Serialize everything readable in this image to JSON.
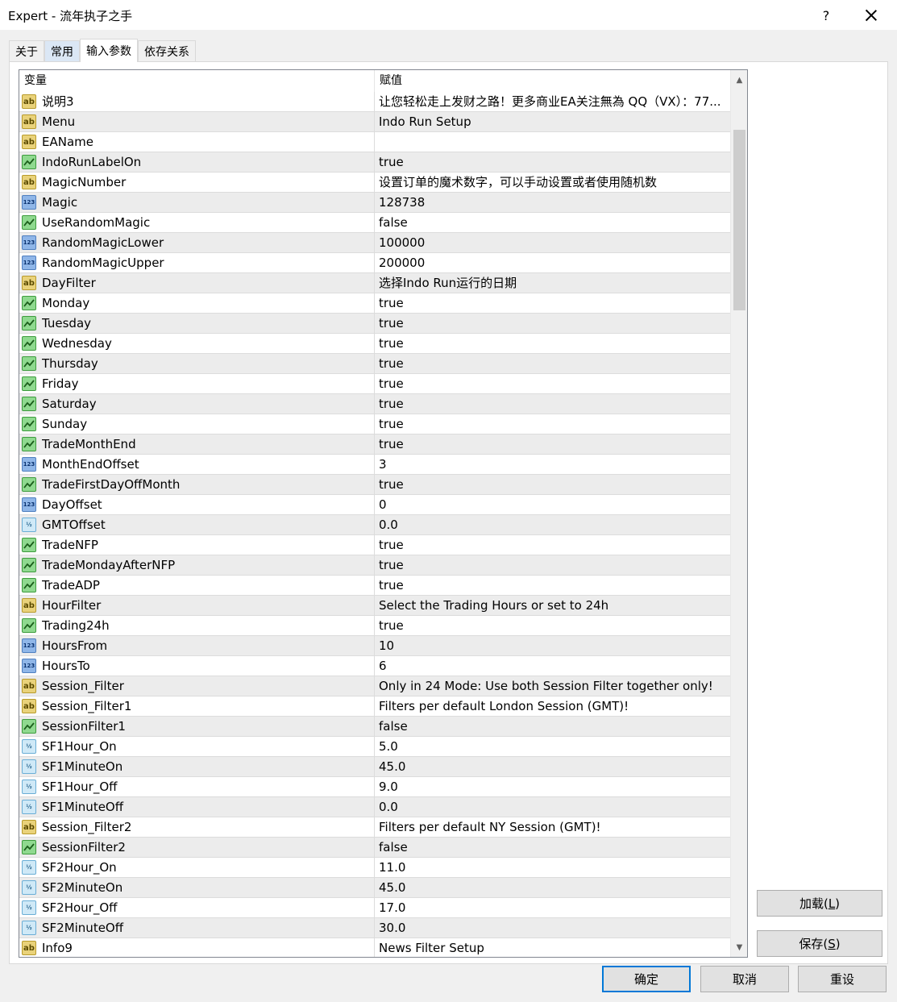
{
  "window": {
    "title": "Expert - 流年执子之手",
    "help_label": "?"
  },
  "tabs": [
    {
      "label": "关于"
    },
    {
      "label": "常用"
    },
    {
      "label": "输入参数"
    },
    {
      "label": "依存关系"
    }
  ],
  "grid": {
    "headers": {
      "variable": "变量",
      "value": "赋值"
    },
    "rows": [
      {
        "type": "ab",
        "name": "说明3",
        "value": "让您轻松走上发财之路！更多商业EA关注無為 QQ（VX）：77..."
      },
      {
        "type": "ab",
        "name": "Menu",
        "value": "Indo Run Setup"
      },
      {
        "type": "ab",
        "name": "EAName",
        "value": ""
      },
      {
        "type": "bool",
        "name": "IndoRunLabelOn",
        "value": "true"
      },
      {
        "type": "ab",
        "name": "MagicNumber",
        "value": "设置订单的魔术数字，可以手动设置或者使用随机数"
      },
      {
        "type": "num",
        "name": "Magic",
        "value": "128738"
      },
      {
        "type": "bool",
        "name": "UseRandomMagic",
        "value": "false"
      },
      {
        "type": "num",
        "name": "RandomMagicLower",
        "value": "100000"
      },
      {
        "type": "num",
        "name": "RandomMagicUpper",
        "value": "200000"
      },
      {
        "type": "ab",
        "name": "DayFilter",
        "value": "选择Indo Run运行的日期"
      },
      {
        "type": "bool",
        "name": "Monday",
        "value": "true"
      },
      {
        "type": "bool",
        "name": "Tuesday",
        "value": "true"
      },
      {
        "type": "bool",
        "name": "Wednesday",
        "value": "true"
      },
      {
        "type": "bool",
        "name": "Thursday",
        "value": "true"
      },
      {
        "type": "bool",
        "name": "Friday",
        "value": "true"
      },
      {
        "type": "bool",
        "name": "Saturday",
        "value": "true"
      },
      {
        "type": "bool",
        "name": "Sunday",
        "value": "true"
      },
      {
        "type": "bool",
        "name": "TradeMonthEnd",
        "value": "true"
      },
      {
        "type": "num",
        "name": "MonthEndOffset",
        "value": "3"
      },
      {
        "type": "bool",
        "name": "TradeFirstDayOffMonth",
        "value": "true"
      },
      {
        "type": "num",
        "name": "DayOffset",
        "value": "0"
      },
      {
        "type": "dbl",
        "name": "GMTOffset",
        "value": "0.0"
      },
      {
        "type": "bool",
        "name": "TradeNFP",
        "value": "true"
      },
      {
        "type": "bool",
        "name": "TradeMondayAfterNFP",
        "value": "true"
      },
      {
        "type": "bool",
        "name": "TradeADP",
        "value": "true"
      },
      {
        "type": "ab",
        "name": "HourFilter",
        "value": "Select the Trading Hours or set to 24h"
      },
      {
        "type": "bool",
        "name": "Trading24h",
        "value": "true"
      },
      {
        "type": "num",
        "name": "HoursFrom",
        "value": "10"
      },
      {
        "type": "num",
        "name": "HoursTo",
        "value": "6"
      },
      {
        "type": "ab",
        "name": "Session_Filter",
        "value": "Only in 24 Mode: Use both Session Filter together only!"
      },
      {
        "type": "ab",
        "name": "Session_Filter1",
        "value": "Filters per default London Session (GMT)!"
      },
      {
        "type": "bool",
        "name": "SessionFilter1",
        "value": "false"
      },
      {
        "type": "dbl",
        "name": "SF1Hour_On",
        "value": "5.0"
      },
      {
        "type": "dbl",
        "name": "SF1MinuteOn",
        "value": "45.0"
      },
      {
        "type": "dbl",
        "name": "SF1Hour_Off",
        "value": "9.0"
      },
      {
        "type": "dbl",
        "name": "SF1MinuteOff",
        "value": "0.0"
      },
      {
        "type": "ab",
        "name": "Session_Filter2",
        "value": "Filters per default NY Session (GMT)!"
      },
      {
        "type": "bool",
        "name": "SessionFilter2",
        "value": "false"
      },
      {
        "type": "dbl",
        "name": "SF2Hour_On",
        "value": "11.0"
      },
      {
        "type": "dbl",
        "name": "SF2MinuteOn",
        "value": "45.0"
      },
      {
        "type": "dbl",
        "name": "SF2Hour_Off",
        "value": "17.0"
      },
      {
        "type": "dbl",
        "name": "SF2MinuteOff",
        "value": "30.0"
      },
      {
        "type": "ab",
        "name": "Info9",
        "value": "News Filter Setup"
      }
    ]
  },
  "side_buttons": {
    "load": {
      "label": "加载(",
      "key": "L",
      "end": ")"
    },
    "save": {
      "label": "保存(",
      "key": "S",
      "end": ")"
    }
  },
  "bottom_buttons": {
    "ok": "确定",
    "cancel": "取消",
    "reset": "重设"
  },
  "icon_glyphs": {
    "ab": "ab",
    "num": "123",
    "dbl": "½"
  },
  "colors": {
    "accent": "#0078d7",
    "row_alt": "#ececec",
    "active_tab": "#ffffff",
    "highlight_tab": "#dbe7f5"
  }
}
